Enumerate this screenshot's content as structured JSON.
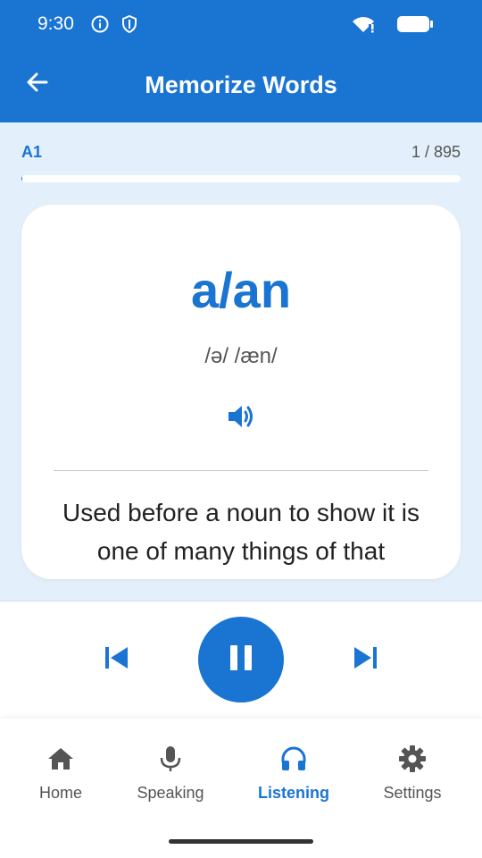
{
  "status_bar": {
    "time": "9:30",
    "icons": [
      "info-icon",
      "shield-icon",
      "wifi-icon",
      "battery-icon"
    ]
  },
  "app_bar": {
    "title": "Memorize Words",
    "back_icon": "arrow-left-icon"
  },
  "progress": {
    "level": "A1",
    "counter": "1 / 895",
    "fraction": 0.0011
  },
  "card": {
    "word": "a/an",
    "phonetic": "/ə/ /æn/",
    "speaker_icon": "speaker-icon",
    "definition": "Used before a noun to show it is one of many things of that"
  },
  "player": {
    "prev_icon": "skip-previous-icon",
    "pause_icon": "pause-icon",
    "next_icon": "skip-next-icon"
  },
  "bottom_nav": {
    "items": [
      {
        "label": "Home",
        "icon": "home-icon"
      },
      {
        "label": "Speaking",
        "icon": "microphone-icon"
      },
      {
        "label": "Listening",
        "icon": "headphones-icon"
      },
      {
        "label": "Settings",
        "icon": "gear-icon"
      }
    ],
    "active": "Listening"
  },
  "colors": {
    "primary": "#1a74d2",
    "background": "#e3effa",
    "card": "#ffffff",
    "text_muted": "#555555"
  }
}
